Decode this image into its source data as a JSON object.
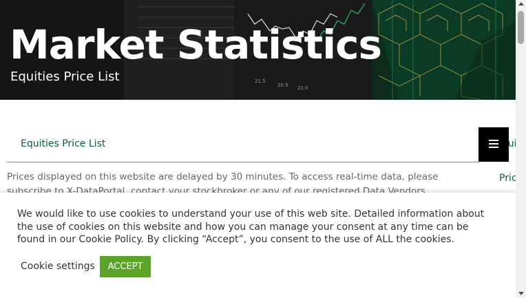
{
  "hero": {
    "title": "Market Statistics",
    "subtitle": "Equities Price List",
    "chart_tick_labels": [
      "21.5",
      "20.5",
      "21.0"
    ]
  },
  "section": {
    "title": "Equities Price List",
    "side_label_1": "Equiti",
    "side_label_2": "Pric"
  },
  "notice": {
    "text": "Prices displayed on this website are delayed by 30 minutes. To access real-time data, please subscribe to X-DataPortal, contact your stockbroker or any of our registered Data Vendors."
  },
  "cookie": {
    "text": "We would like to use cookies to understand your use of this web site. Detailed information about the use of cookies on this website and how you can manage your consent at any time can be found in our Cookie Policy. By clicking “Accept”, you consent to the use of ALL the cookies.",
    "settings_label": "Cookie settings",
    "accept_label": "ACCEPT"
  },
  "colors": {
    "accent_green": "#0b5a3c",
    "accept_button": "#5ba32a",
    "menu_button": "#000000"
  },
  "icons": [
    "hamburger-menu-icon",
    "scroll-up-arrow-icon",
    "scroll-down-arrow-icon"
  ]
}
